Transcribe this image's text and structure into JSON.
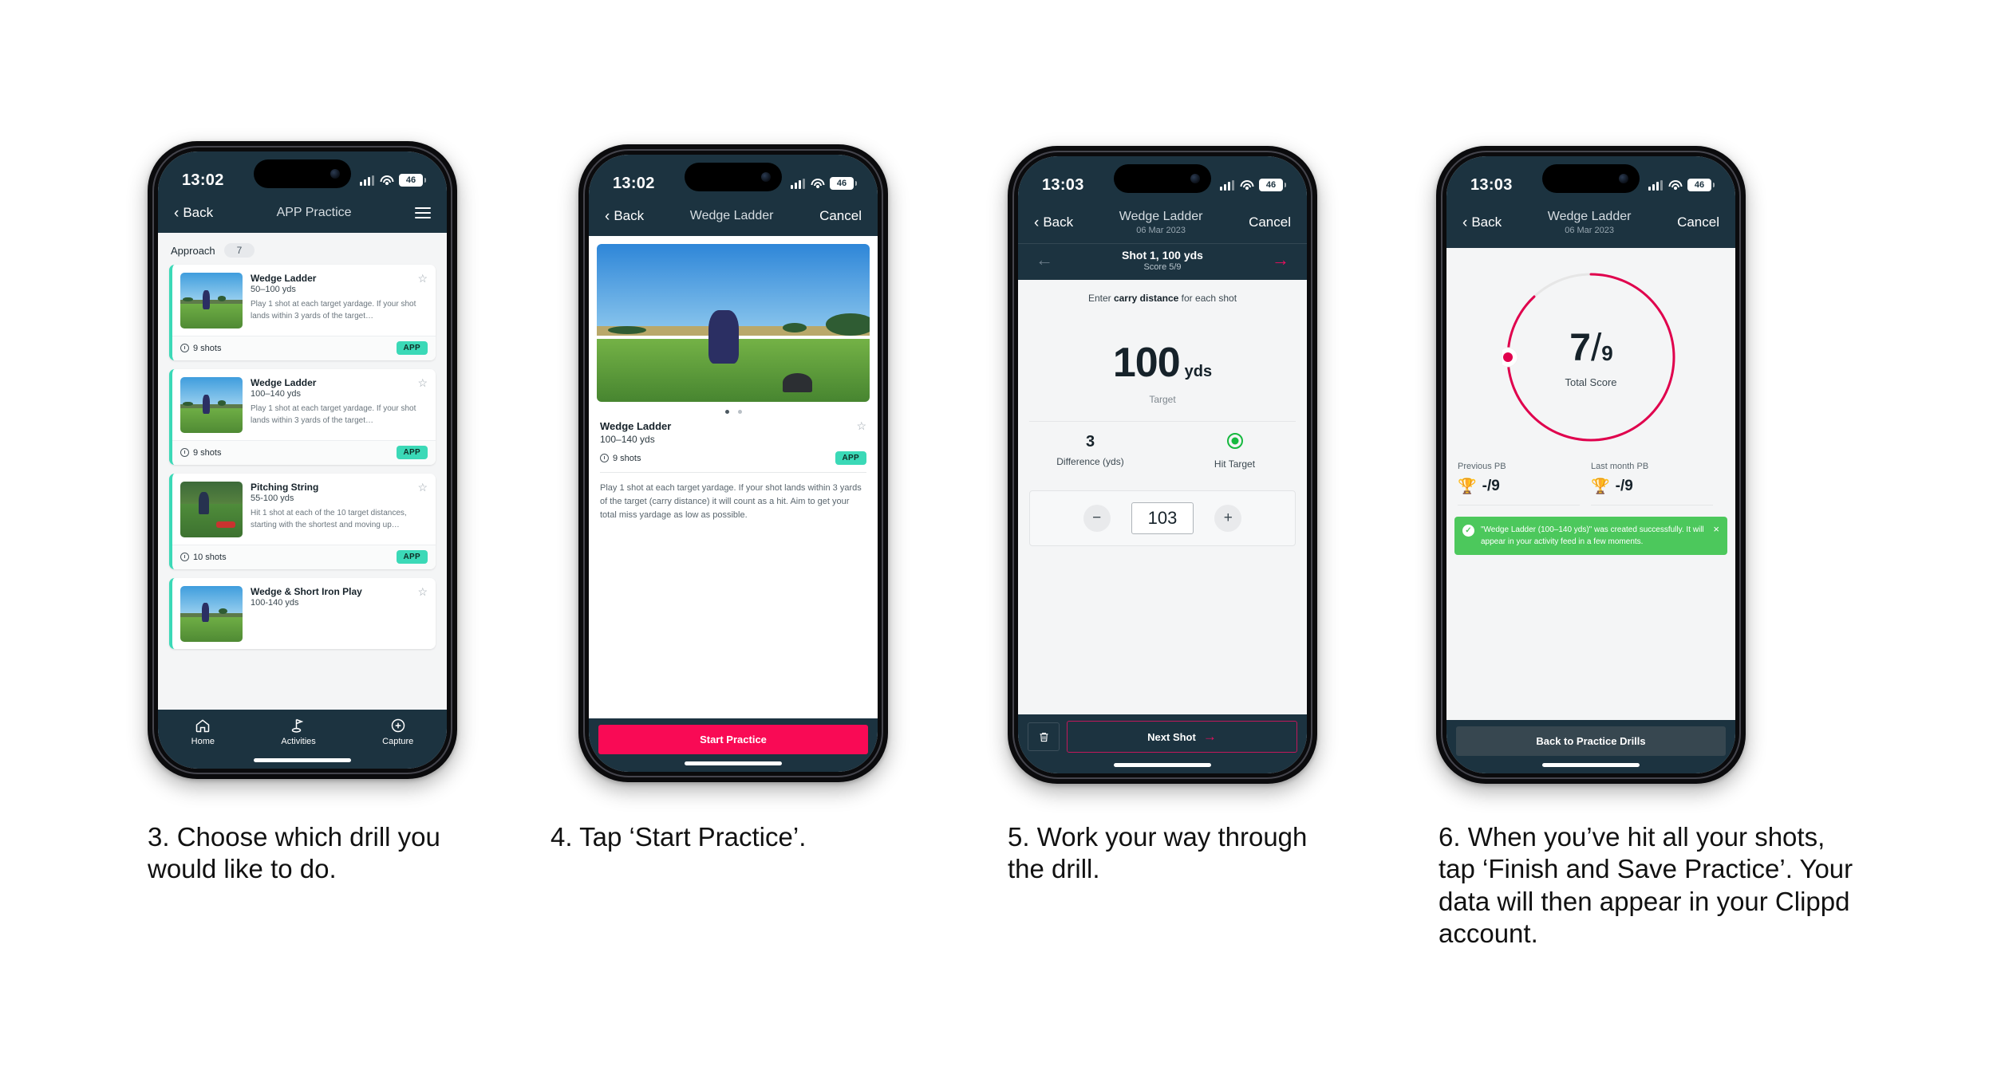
{
  "phones": [
    {
      "id": "phone-drill-list",
      "status": {
        "time": "13:02",
        "battery": "46"
      },
      "nav": {
        "back": "Back",
        "title": "APP Practice",
        "menu_icon": "hamburger-icon"
      },
      "category": {
        "label": "Approach",
        "count": "7"
      },
      "cards": [
        {
          "title": "Wedge Ladder",
          "range": "50–100 yds",
          "desc": "Play 1 shot at each target yardage. If your shot lands within 3 yards of the target…",
          "shots": "9 shots",
          "badge": "APP"
        },
        {
          "title": "Wedge Ladder",
          "range": "100–140 yds",
          "desc": "Play 1 shot at each target yardage. If your shot lands within 3 yards of the target…",
          "shots": "9 shots",
          "badge": "APP"
        },
        {
          "title": "Pitching String",
          "range": "55-100 yds",
          "desc": "Hit 1 shot at each of the 10 target distances, starting with the shortest and moving up…",
          "shots": "10 shots",
          "badge": "APP"
        },
        {
          "title": "Wedge & Short Iron Play",
          "range": "100-140 yds",
          "desc": "",
          "shots": "",
          "badge": ""
        }
      ],
      "tabs": [
        {
          "label": "Home",
          "icon": "home-icon"
        },
        {
          "label": "Activities",
          "icon": "golf-flag-icon"
        },
        {
          "label": "Capture",
          "icon": "plus-circle-icon"
        }
      ]
    },
    {
      "id": "phone-drill-detail",
      "status": {
        "time": "13:02",
        "battery": "46"
      },
      "nav": {
        "back": "Back",
        "title": "Wedge Ladder",
        "cancel": "Cancel"
      },
      "detail": {
        "title": "Wedge Ladder",
        "range": "100–140 yds",
        "shots": "9 shots",
        "badge": "APP",
        "description": "Play 1 shot at each target yardage. If your shot lands within 3 yards of the target (carry distance) it will count as a hit. Aim to get your total miss yardage as low as possible.",
        "cta": "Start Practice"
      }
    },
    {
      "id": "phone-shot-entry",
      "status": {
        "time": "13:03",
        "battery": "46"
      },
      "nav": {
        "back": "Back",
        "title": "Wedge Ladder",
        "subtitle": "06 Mar 2023",
        "cancel": "Cancel"
      },
      "subnav": {
        "shot": "Shot 1, 100 yds",
        "score": "Score 5/9"
      },
      "entry": {
        "hint_pre": "Enter ",
        "hint_bold": "carry distance",
        "hint_post": " for each shot",
        "target_value": "100",
        "target_unit": "yds",
        "target_label": "Target",
        "difference_value": "3",
        "difference_label": "Difference (yds)",
        "hit_label": "Hit Target",
        "stepper_value": "103",
        "minus": "−",
        "plus": "+",
        "next_label": "Next Shot",
        "delete_icon": "trash-icon"
      }
    },
    {
      "id": "phone-score-summary",
      "status": {
        "time": "13:03",
        "battery": "46"
      },
      "nav": {
        "back": "Back",
        "title": "Wedge Ladder",
        "subtitle": "06 Mar 2023",
        "cancel": "Cancel"
      },
      "summary": {
        "score_numerator": "7",
        "score_denominator": "9",
        "score_label": "Total Score",
        "ring_percent": 88,
        "previous_pb_label": "Previous PB",
        "previous_pb_value": "-/9",
        "last_month_pb_label": "Last month PB",
        "last_month_pb_value": "-/9",
        "toast_message": "\"Wedge Ladder (100–140 yds)\" was created successfully. It will appear in your activity feed in a few moments.",
        "toast_close": "×",
        "back_button": "Back to Practice Drills"
      }
    }
  ],
  "captions": [
    "3. Choose which drill you would like to do.",
    "4. Tap ‘Start Practice’.",
    "5. Work your way through the drill.",
    "6. When you’ve hit all your shots, tap ‘Finish and Save Practice’. Your data will then appear in your Clippd account."
  ],
  "colors": {
    "navy": "#1c3340",
    "teal": "#3bd9b7",
    "pink": "#f90a55",
    "green": "#4cc85c",
    "hit_green": "#16b93f"
  }
}
